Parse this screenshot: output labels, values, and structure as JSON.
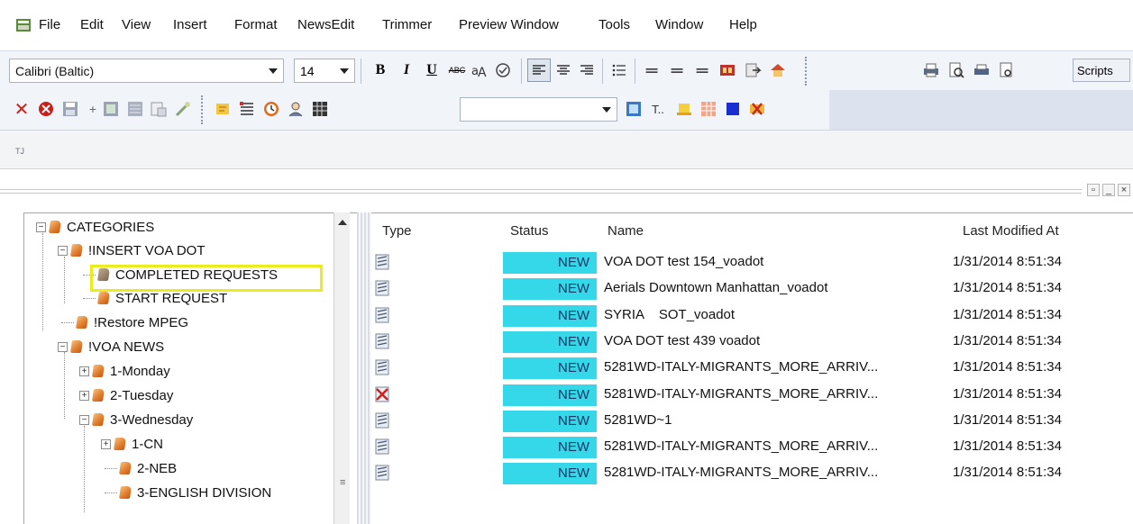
{
  "menu": {
    "items": [
      "File",
      "Edit",
      "View",
      "Insert",
      "Format",
      "NewsEdit",
      "Trimmer",
      "Preview Window",
      "Tools",
      "Window",
      "Help"
    ]
  },
  "toolbar": {
    "font_name": "Calibri (Baltic)",
    "font_size": "14",
    "bold_label": "B",
    "italic_label": "I",
    "underline_label": "U",
    "strike_label": "ABC",
    "scripts_label": "Scripts"
  },
  "strip": {
    "label": "TJ"
  },
  "tree": {
    "nodes": [
      {
        "label": "CATEGORIES"
      },
      {
        "label": "!INSERT VOA DOT"
      },
      {
        "label": "COMPLETED REQUESTS"
      },
      {
        "label": "START REQUEST"
      },
      {
        "label": "!Restore MPEG"
      },
      {
        "label": "!VOA NEWS"
      },
      {
        "label": "1-Monday"
      },
      {
        "label": "2-Tuesday"
      },
      {
        "label": "3-Wednesday"
      },
      {
        "label": "1-CN"
      },
      {
        "label": "2-NEB"
      },
      {
        "label": "3-ENGLISH DIVISION"
      }
    ]
  },
  "list": {
    "columns": {
      "type": "Type",
      "status": "Status",
      "name": "Name",
      "modified": "Last Modified At"
    },
    "rows": [
      {
        "status": "NEW",
        "name": "VOA DOT test 154_voadot",
        "modified": "1/31/2014 8:51:34",
        "icon": "script-icon"
      },
      {
        "status": "NEW",
        "name": "Aerials Downtown Manhattan_voadot",
        "modified": "1/31/2014 8:51:34",
        "icon": "script-icon"
      },
      {
        "status": "NEW",
        "name": "SYRIA    SOT_voadot",
        "modified": "1/31/2014 8:51:34",
        "icon": "script-icon"
      },
      {
        "status": "NEW",
        "name": "VOA DOT test 439 voadot",
        "modified": "1/31/2014 8:51:34",
        "icon": "script-icon"
      },
      {
        "status": "NEW",
        "name": "5281WD-ITALY-MIGRANTS_MORE_ARRIV...",
        "modified": "1/31/2014 8:51:34",
        "icon": "script-icon"
      },
      {
        "status": "NEW",
        "name": "5281WD-ITALY-MIGRANTS_MORE_ARRIV...",
        "modified": "1/31/2014 8:51:34",
        "icon": "deleted-script-icon"
      },
      {
        "status": "NEW",
        "name": "5281WD~1",
        "modified": "1/31/2014 8:51:34",
        "icon": "script-icon"
      },
      {
        "status": "NEW",
        "name": "5281WD-ITALY-MIGRANTS_MORE_ARRIV...",
        "modified": "1/31/2014 8:51:34",
        "icon": "script-icon"
      },
      {
        "status": "NEW",
        "name": "5281WD-ITALY-MIGRANTS_MORE_ARRIV...",
        "modified": "1/31/2014 8:51:34",
        "icon": "script-icon"
      }
    ]
  },
  "colors": {
    "status_new": "#34d8e8",
    "highlight": "#ecec1d"
  }
}
